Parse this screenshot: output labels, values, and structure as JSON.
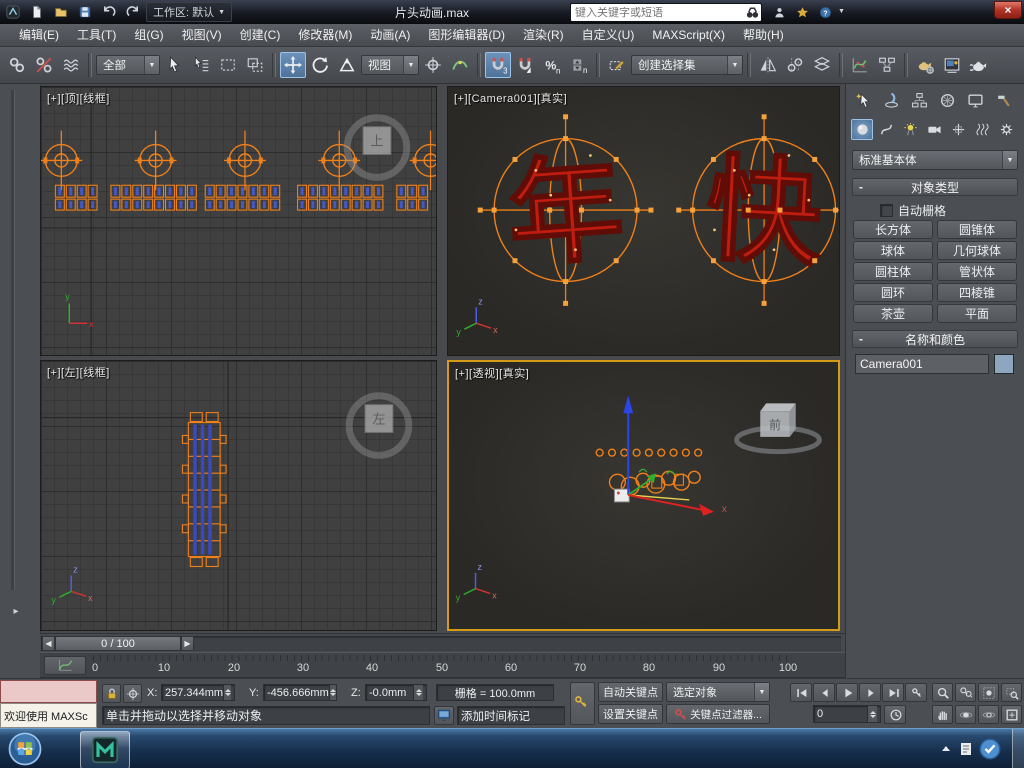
{
  "titlebar": {
    "workspace": "工作区: 默认",
    "title": "片头动画.max",
    "search_placeholder": "键入关键字或短语"
  },
  "menubar": [
    "编辑(E)",
    "工具(T)",
    "组(G)",
    "视图(V)",
    "创建(C)",
    "修改器(M)",
    "动画(A)",
    "图形编辑器(D)",
    "渲染(R)",
    "自定义(U)",
    "MAXScript(X)",
    "帮助(H)"
  ],
  "toolbar": {
    "filter": "全部",
    "coord_system": "视图",
    "selection_set": "创建选择集"
  },
  "viewports": {
    "top_label": "[+][顶][线框]",
    "camera_label": "[+][Camera001][真实]",
    "left_label": "[+][左][线框]",
    "persp_label": "[+][透视][真实]",
    "char_year": "年",
    "char_fast": "快",
    "viewcube_top": "上",
    "viewcube_left": "左",
    "viewcube_front": "前"
  },
  "command_panel": {
    "object_category": "标准基本体",
    "object_type_rollout": "对象类型",
    "autogrid": "自动栅格",
    "object_buttons": [
      "长方体",
      "圆锥体",
      "球体",
      "几何球体",
      "圆柱体",
      "管状体",
      "圆环",
      "四棱锥",
      "茶壶",
      "平面"
    ],
    "name_color_rollout": "名称和颜色",
    "object_name": "Camera001",
    "object_color": "#8ea6c0"
  },
  "timeline": {
    "slider": "0 / 100",
    "ticks": [
      "0",
      "10",
      "20",
      "30",
      "40",
      "50",
      "60",
      "70",
      "80",
      "90",
      "100"
    ]
  },
  "statusbar": {
    "listener_text": "欢迎使用 MAXSc",
    "x_label": "X:",
    "x_value": "257.344mm",
    "y_label": "Y:",
    "y_value": "-456.666mm",
    "z_label": "Z:",
    "z_value": "-0.0mm",
    "grid_value": "栅格 = 100.0mm",
    "prompt": "单击并拖动以选择并移动对象",
    "time_tag": "添加时间标记",
    "auto_key": "自动关键点",
    "set_key": "设置关键点",
    "selection_filter": "选定对象",
    "key_filters": "关键点过滤器...",
    "frame": "0"
  },
  "colors": {
    "accent_orange": "#f08019",
    "active_viewport_border": "#d49c16",
    "char_red": "#bf1d10"
  }
}
